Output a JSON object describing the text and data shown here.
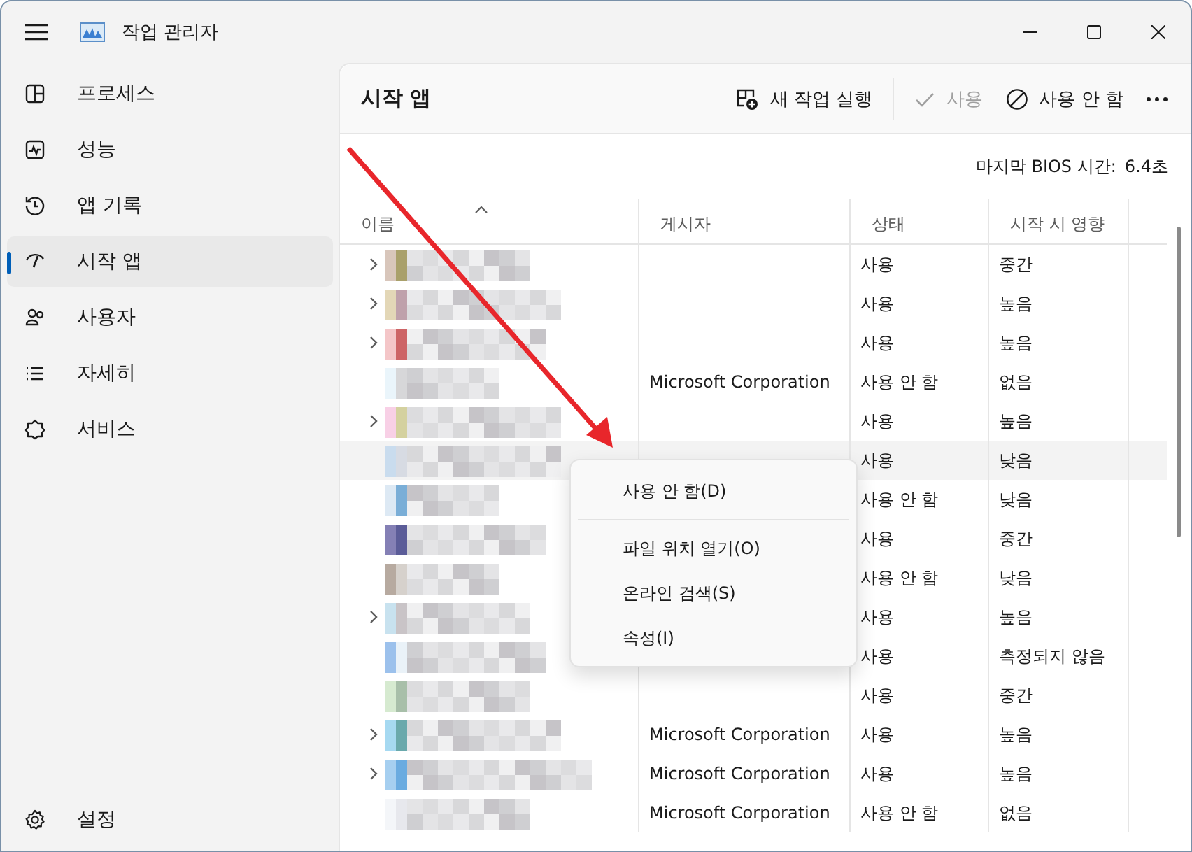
{
  "window": {
    "title": "작업 관리자"
  },
  "sidebar": {
    "items": [
      {
        "label": "프로세스",
        "selected": false
      },
      {
        "label": "성능",
        "selected": false
      },
      {
        "label": "앱 기록",
        "selected": false
      },
      {
        "label": "시작 앱",
        "selected": true
      },
      {
        "label": "사용자",
        "selected": false
      },
      {
        "label": "자세히",
        "selected": false
      },
      {
        "label": "서비스",
        "selected": false
      }
    ],
    "footer": {
      "label": "설정"
    }
  },
  "page": {
    "title": "시작 앱"
  },
  "toolbar": [
    {
      "kind": "newtask",
      "label": "새 작업 실행",
      "disabled": false
    },
    {
      "kind": "enable",
      "label": "사용",
      "disabled": true
    },
    {
      "kind": "disable",
      "label": "사용 안 함",
      "disabled": false
    },
    {
      "kind": "more",
      "disabled": false
    }
  ],
  "bios_time": {
    "label": "마지막 BIOS 시간:",
    "value": "6.4초"
  },
  "table": {
    "columns": [
      "이름",
      "게시자",
      "상태",
      "시작 시 영향"
    ],
    "rows": [
      {
        "kind": "blurred",
        "expandable": true,
        "selected": false,
        "status": "사용",
        "impact": "중간"
      },
      {
        "kind": "blurred",
        "expandable": true,
        "selected": false,
        "status": "사용",
        "impact": "높음"
      },
      {
        "kind": "blurred",
        "expandable": true,
        "selected": false,
        "status": "사용",
        "impact": "높음"
      },
      {
        "kind": "blurred",
        "expandable": false,
        "selected": false,
        "publisher": "Microsoft Corporation",
        "status": "사용 안 함",
        "impact": "없음"
      },
      {
        "kind": "blurred",
        "expandable": true,
        "selected": false,
        "status": "사용",
        "impact": "높음"
      },
      {
        "kind": "blurred",
        "expandable": false,
        "selected": true,
        "status": "사용",
        "impact": "낮음"
      },
      {
        "kind": "blurred",
        "expandable": false,
        "selected": false,
        "status": "사용 안 함",
        "impact": "낮음"
      },
      {
        "kind": "blurred",
        "expandable": false,
        "selected": false,
        "status": "사용",
        "impact": "중간"
      },
      {
        "kind": "blurred",
        "expandable": false,
        "selected": false,
        "status": "사용 안 함",
        "impact": "낮음"
      },
      {
        "kind": "blurred",
        "expandable": true,
        "selected": false,
        "status": "사용",
        "impact": "높음"
      },
      {
        "kind": "blurred",
        "expandable": false,
        "selected": false,
        "status": "사용",
        "impact": "측정되지 않음"
      },
      {
        "kind": "blurred",
        "expandable": false,
        "selected": false,
        "status": "사용",
        "impact": "중간"
      },
      {
        "kind": "blurred",
        "expandable": true,
        "selected": false,
        "publisher": "Microsoft Corporation",
        "status": "사용",
        "impact": "높음"
      },
      {
        "kind": "blurred",
        "expandable": true,
        "selected": false,
        "publisher": "Microsoft Corporation",
        "status": "사용",
        "impact": "높음"
      },
      {
        "kind": "blurred",
        "expandable": false,
        "selected": false,
        "publisher": "Microsoft Corporation",
        "status": "사용 안 함",
        "impact": "없음"
      }
    ]
  },
  "context_menu": {
    "items": [
      {
        "kind": "item",
        "label": "사용 안 함(D)"
      },
      {
        "kind": "separator"
      },
      {
        "kind": "item",
        "label": "파일 위치 열기(O)"
      },
      {
        "kind": "item",
        "label": "온라인 검색(S)"
      },
      {
        "kind": "item",
        "label": "속성(I)"
      }
    ]
  }
}
